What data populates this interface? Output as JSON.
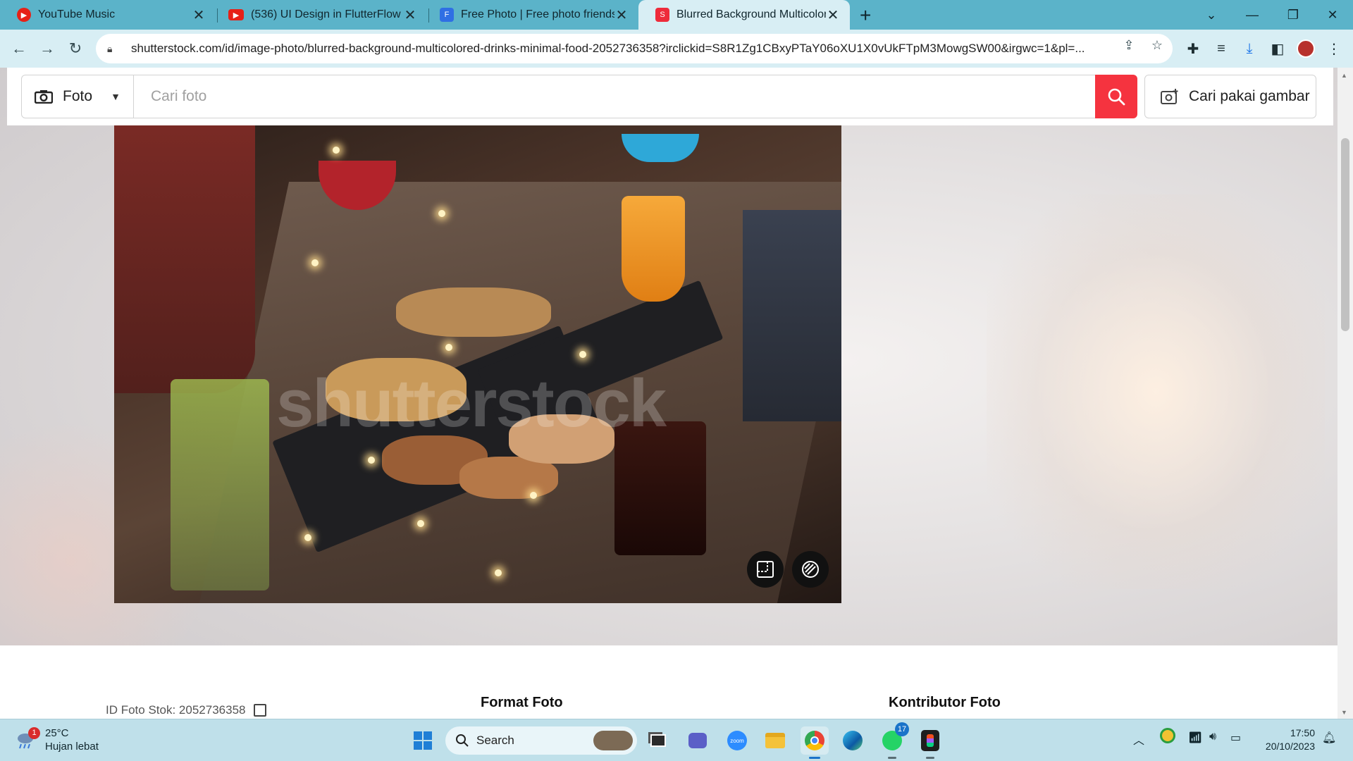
{
  "browser": {
    "tabs": [
      {
        "title": "YouTube Music",
        "icon": "youtube-music-icon"
      },
      {
        "title": "(536) UI Design in FlutterFlow || ",
        "icon": "youtube-icon"
      },
      {
        "title": "Free Photo | Free photo friends t",
        "icon": "freepik-icon"
      },
      {
        "title": "Blurred Background Multicolore",
        "icon": "shutterstock-icon",
        "active": true
      }
    ],
    "url": "shutterstock.com/id/image-photo/blurred-background-multicolored-drinks-minimal-food-2052736358?irclickid=S8R1Zg1CBxyPTaY06oXU1X0vUkFTpM3MowgSW00&irgwc=1&pl=..."
  },
  "search": {
    "type_label": "Foto",
    "placeholder": "Cari foto",
    "image_search_label": "Cari pakai gambar"
  },
  "photo": {
    "watermark": "shutterstock"
  },
  "info": {
    "stock_id": "ID Foto Stok: 2052736358",
    "format_heading": "Format Foto",
    "contributor_heading": "Kontributor Foto"
  },
  "taskbar": {
    "weather_temp": "25°C",
    "weather_desc": "Hujan lebat",
    "weather_badge": "1",
    "search_label": "Search",
    "whatsapp_badge": "17",
    "time": "17:50",
    "date": "20/10/2023"
  },
  "colors": {
    "accent": "#f5333f",
    "tabstrip": "#5bb3c9",
    "toolbar": "#d8eef4",
    "taskbar": "#bfe0ea"
  }
}
